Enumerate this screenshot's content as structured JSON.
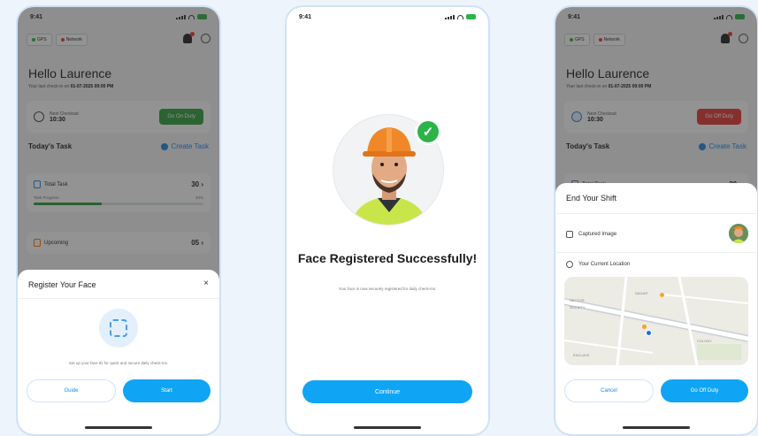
{
  "status_bar": {
    "time": "9:41"
  },
  "dashboard": {
    "chip_gps": "GPS",
    "chip_network": "Network",
    "greeting": "Hello Laurence",
    "last_checkin_prefix": "Your last check-in on ",
    "last_checkin_value": "01-07-2025 09:00 PM",
    "shift_label": "Next Checkout",
    "shift_time": "10:30",
    "on_duty_label": "Go On Duty",
    "off_duty_label": "Go Off Duty",
    "todays_task": "Today's Task",
    "create_task": "Create Task",
    "total_task_label": "Total Task",
    "total_task_value": "30",
    "task_progress_label": "Task Progress",
    "task_progress_percent": "40%",
    "task_progress_fraction": 0.4,
    "upcoming_label": "Upcoming",
    "upcoming_value": "05"
  },
  "register_sheet": {
    "title": "Register Your Face",
    "close": "×",
    "description": "Set up your face ID for quick and secure daily check-ins.",
    "guide_button": "Guide",
    "start_button": "Start"
  },
  "success_screen": {
    "title": "Face Registered Successfully!",
    "subtitle": "Your face is now securely registered for daily check-ins.",
    "continue_button": "Continue"
  },
  "end_shift_sheet": {
    "title": "End Your Shift",
    "captured_image": "Captured Image",
    "current_location": "Your Current Location",
    "cancel_button": "Cancel",
    "off_duty_button": "Go Off Duty"
  },
  "map": {
    "labels": [
      "SECTOR",
      "SOCIETY",
      "NAGAR",
      "COLONY",
      "ENCLAVE"
    ]
  },
  "colors": {
    "primary": "#10a4f4",
    "on_duty_green": "#2e9e3b",
    "off_duty_red": "#e53935",
    "success_green": "#2db34a"
  }
}
